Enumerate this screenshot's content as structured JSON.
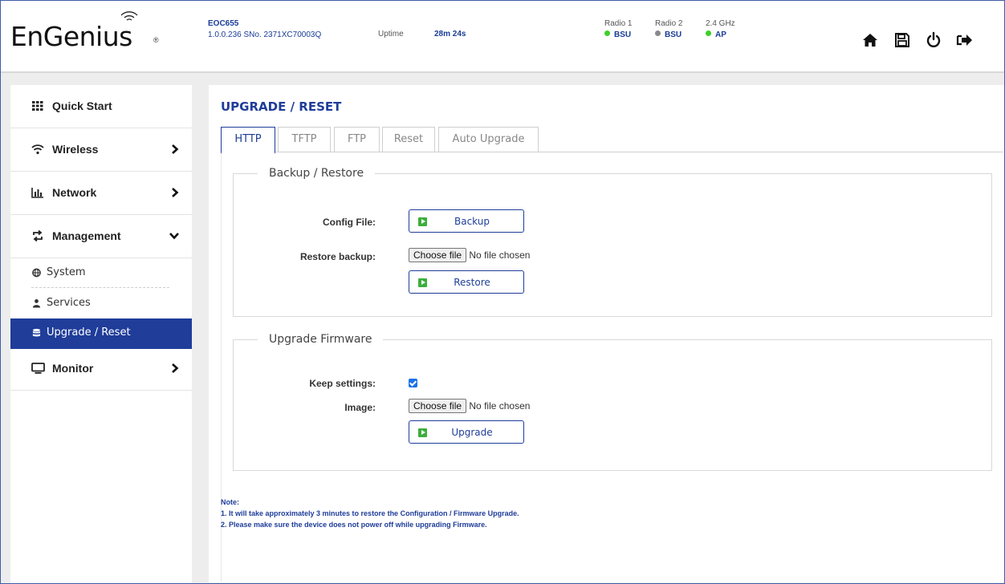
{
  "header": {
    "logo": "EnGenius",
    "logo_reg": "®",
    "device": {
      "model": "EOC655",
      "firmware": "1.0.0.236 SNo. 2371XC70003Q"
    },
    "uptime_label": "Uptime",
    "uptime_value": "28m 24s",
    "radios": [
      {
        "label": "Radio 1",
        "status": "BSU",
        "status_color": "#3ecf2a"
      },
      {
        "label": "Radio 2",
        "status": "BSU",
        "status_color": "#8a8a8a"
      },
      {
        "label": "2.4 GHz",
        "status": "AP",
        "status_color": "#3ecf2a"
      }
    ],
    "icons": [
      "home-icon",
      "save-icon",
      "power-icon",
      "logout-icon"
    ]
  },
  "sidebar": {
    "items": [
      {
        "label": "Quick Start",
        "icon": "grid-icon"
      },
      {
        "label": "Wireless",
        "icon": "wifi-icon"
      },
      {
        "label": "Network",
        "icon": "bar-chart-icon"
      },
      {
        "label": "Management",
        "icon": "exchange-icon"
      },
      {
        "label": "Monitor",
        "icon": "monitor-icon"
      }
    ],
    "management_sub": [
      {
        "label": "System",
        "icon": "globe-icon"
      },
      {
        "label": "Services",
        "icon": "user-icon"
      },
      {
        "label": "Upgrade / Reset",
        "icon": "database-icon"
      }
    ]
  },
  "main": {
    "title": "UPGRADE / RESET",
    "tabs": [
      "HTTP",
      "TFTP",
      "FTP",
      "Reset",
      "Auto Upgrade"
    ],
    "active_tab": "HTTP",
    "backup": {
      "legend": "Backup / Restore",
      "config_label": "Config File:",
      "backup_btn": "Backup",
      "restore_label": "Restore backup:",
      "choose_btn": "Choose file",
      "no_file": "No file chosen",
      "restore_btn": "Restore"
    },
    "firmware": {
      "legend": "Upgrade Firmware",
      "keep_label": "Keep settings:",
      "keep_checked": true,
      "image_label": "Image:",
      "choose_btn": "Choose file",
      "no_file": "No file chosen",
      "upgrade_btn": "Upgrade"
    },
    "note": {
      "title": "Note:",
      "lines": [
        "1. It will take approximately 3 minutes to restore the Configuration / Firmware Upgrade.",
        "2. Please make sure the device does not power off while upgrading Firmware."
      ]
    }
  }
}
